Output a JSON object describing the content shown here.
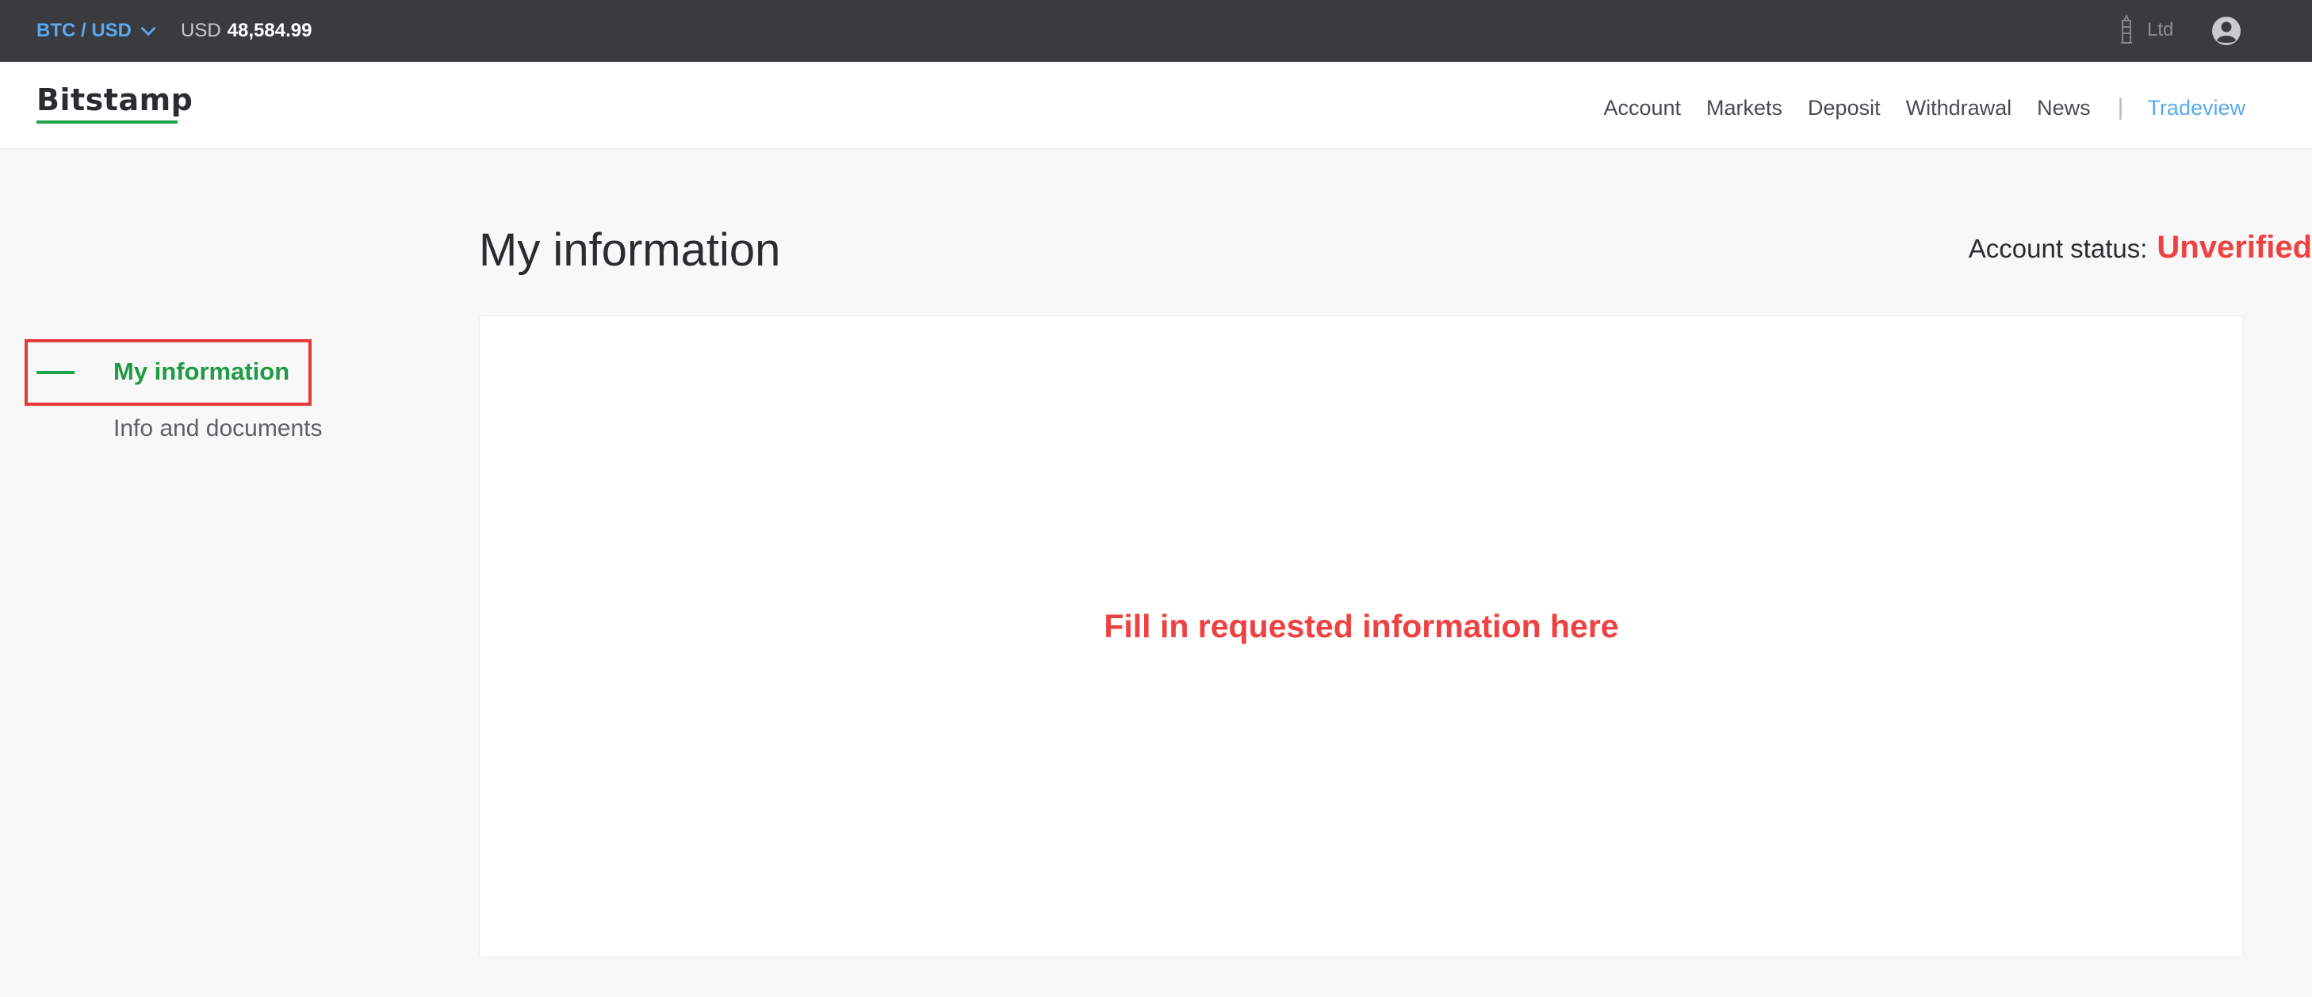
{
  "topbar": {
    "pair_label": "BTC / USD",
    "price_currency": "USD",
    "price_value": "48,584.99",
    "entity_label": "Ltd"
  },
  "header": {
    "logo": "Bitstamp",
    "nav": {
      "account": "Account",
      "markets": "Markets",
      "deposit": "Deposit",
      "withdrawal": "Withdrawal",
      "news": "News",
      "separator": "|",
      "tradeview": "Tradeview"
    }
  },
  "sidebar": {
    "items": [
      {
        "label": "My information",
        "active": true
      },
      {
        "label": "Info and documents",
        "active": false
      }
    ]
  },
  "main": {
    "title": "My information",
    "status_label": "Account status:",
    "status_value": "Unverified",
    "panel_message": "Fill in requested information here"
  },
  "colors": {
    "accent_green": "#1fa34a",
    "accent_blue": "#5aa9ef",
    "alert_red": "#ef4141",
    "topbar_bg": "#3a3b3f"
  },
  "icons": {
    "pair_dropdown": "chevron-down-icon",
    "entity": "tower-icon",
    "user": "user-circle-icon"
  }
}
